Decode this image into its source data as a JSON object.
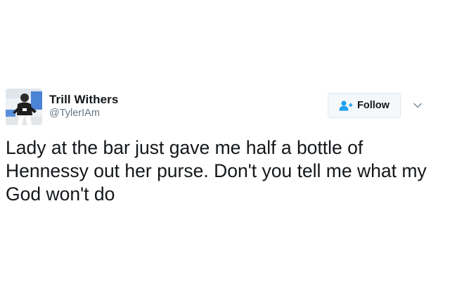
{
  "user": {
    "display_name": "Trill Withers",
    "handle": "@TylerIAm",
    "avatar_icon": "profile-photo"
  },
  "actions": {
    "follow_label": "Follow",
    "follow_icon": "add-user-icon",
    "menu_icon": "chevron-down-icon"
  },
  "tweet": {
    "text": "Lady at the bar just gave me half a bottle of Hennessy out her purse. Don't you tell me what my God won't do"
  },
  "colors": {
    "text": "#14171a",
    "secondary": "#657786",
    "accent": "#1da1f2",
    "button_bg": "#f5f8fa",
    "button_border": "#e1e8ed"
  }
}
